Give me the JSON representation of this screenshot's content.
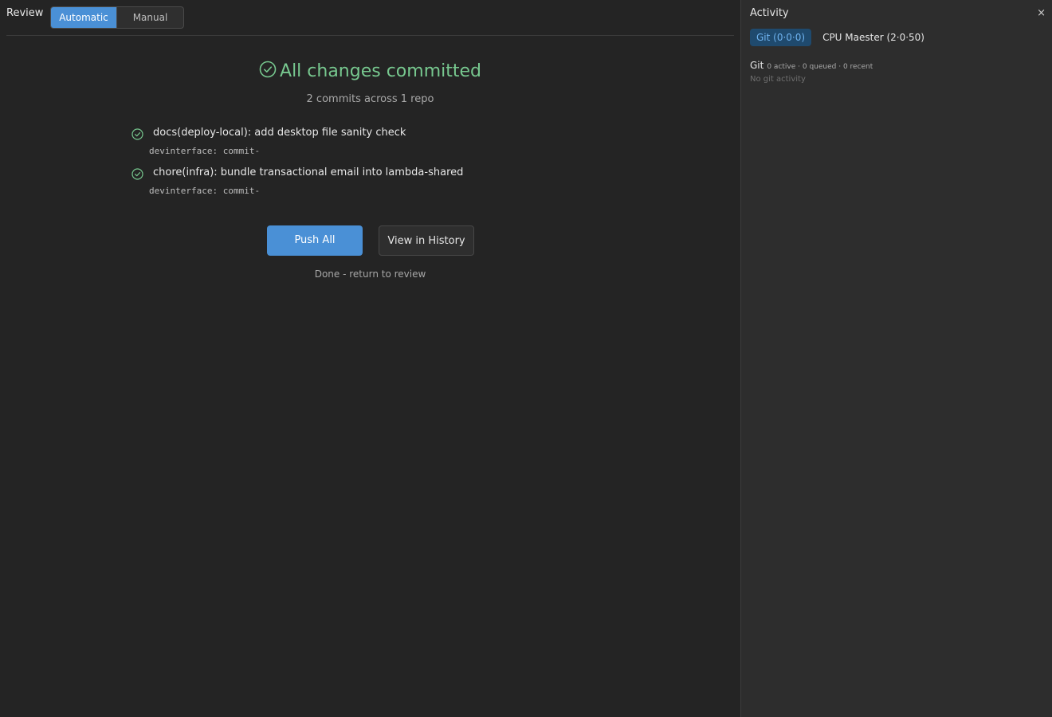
{
  "review": {
    "label": "Review",
    "mode_automatic": "Automatic",
    "mode_manual": "Manual"
  },
  "summary": {
    "title": "All changes committed",
    "subtitle": "2 commits across 1 repo"
  },
  "commits": [
    {
      "message": "docs(deploy-local): add desktop file sanity check",
      "meta": "devinterface: commit-"
    },
    {
      "message": "chore(infra): bundle transactional email into lambda-shared",
      "meta": "devinterface: commit-"
    }
  ],
  "actions": {
    "push_all": "Push All",
    "view_history": "View in History",
    "done": "Done - return to review"
  },
  "activity": {
    "title": "Activity",
    "close": "×",
    "tabs": [
      {
        "label": "Git (0·0·0)",
        "active": true
      },
      {
        "label": "CPU Maester (2·0·50)",
        "active": false
      }
    ],
    "git_label": "Git",
    "git_stats": "0 active · 0 queued · 0 recent",
    "empty_text": "No git activity"
  },
  "colors": {
    "accent": "#4a90d6",
    "success": "#77c88f",
    "background": "#242424",
    "panel": "#2d2d2d"
  },
  "icons": {
    "success": "check-circle-icon",
    "close": "close-icon"
  }
}
